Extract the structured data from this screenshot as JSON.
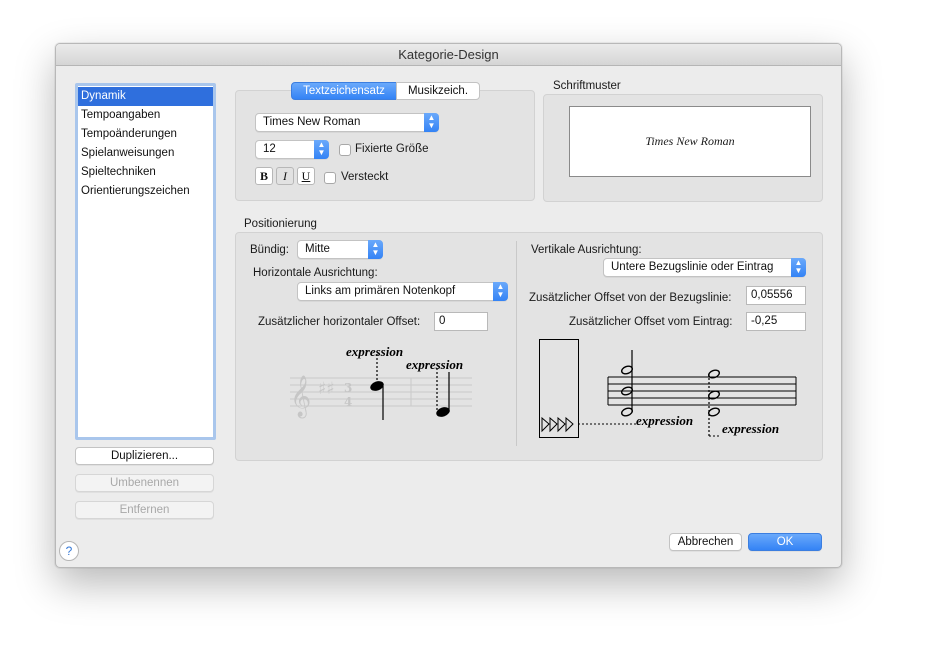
{
  "window": {
    "title": "Kategorie-Design"
  },
  "sidebar": {
    "items": [
      {
        "label": "Dynamik",
        "selected": true
      },
      {
        "label": "Tempoangaben"
      },
      {
        "label": "Tempoänderungen"
      },
      {
        "label": "Spielanweisungen"
      },
      {
        "label": "Spieltechniken"
      },
      {
        "label": "Orientierungszeichen"
      }
    ],
    "duplicate_label": "Duplizieren...",
    "rename_label": "Umbenennen",
    "remove_label": "Entfernen"
  },
  "font": {
    "tabs": [
      {
        "label": "Textzeichensatz",
        "active": true
      },
      {
        "label": "Musikzeich."
      }
    ],
    "family": "Times New Roman",
    "size": "12",
    "fixed_size_label": "Fixierte Größe",
    "bold_label": "B",
    "italic_label": "I",
    "underline_label": "U",
    "hidden_label": "Versteckt"
  },
  "sample": {
    "title": "Schriftmuster",
    "text": "Times New Roman"
  },
  "positioning": {
    "title": "Positionierung",
    "align_label": "Bündig:",
    "align_value": "Mitte",
    "horizontal_label": "Horizontale Ausrichtung:",
    "horizontal_value": "Links am primären Notenkopf",
    "h_offset_label": "Zusätzlicher horizontaler Offset:",
    "h_offset_value": "0",
    "vertical_label": "Vertikale Ausrichtung:",
    "vertical_value": "Untere Bezugslinie oder Eintrag",
    "baseline_offset_label": "Zusätzlicher Offset von der Bezugslinie:",
    "baseline_offset_value": "0,05556",
    "entry_offset_label": "Zusätzlicher Offset vom Eintrag:",
    "entry_offset_value": "-0,25",
    "example_text": "expression"
  },
  "footer": {
    "cancel_label": "Abbrechen",
    "ok_label": "OK",
    "help_label": "?"
  },
  "colors": {
    "accent": "#3483f5",
    "selection": "#2f6fdd"
  }
}
